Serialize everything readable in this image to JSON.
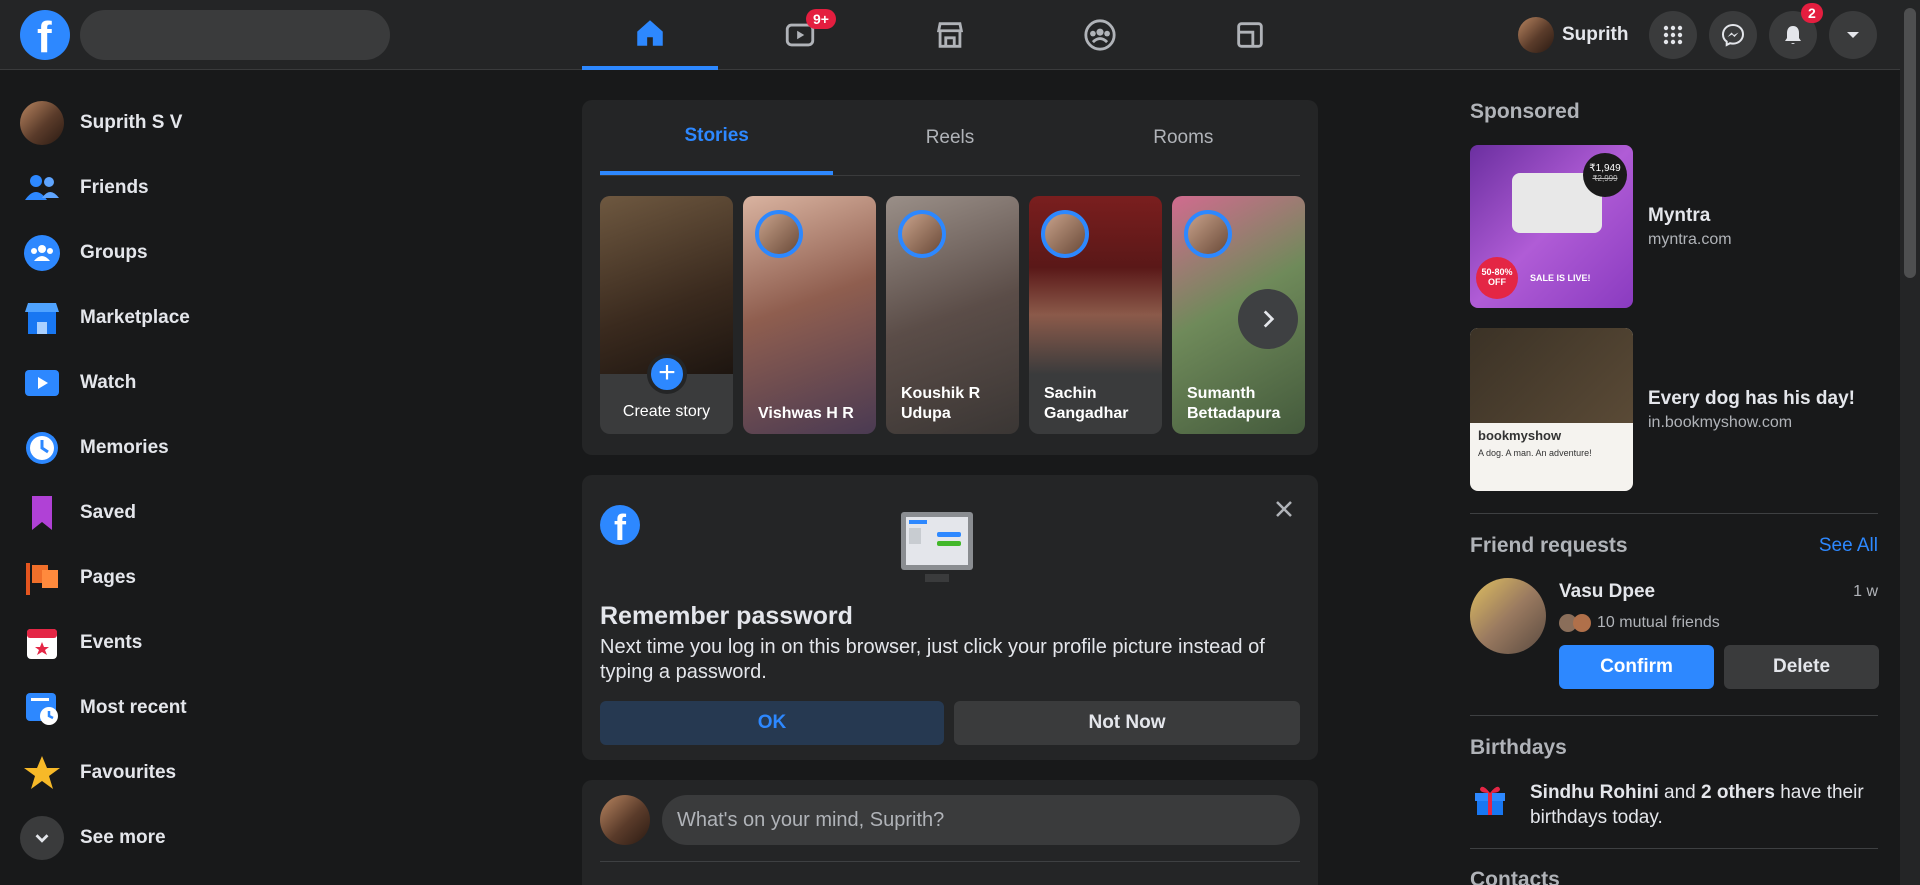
{
  "header": {
    "logo_letter": "f",
    "nav_tabs": [
      {
        "name": "home",
        "active": true
      },
      {
        "name": "watch",
        "badge": "9+"
      },
      {
        "name": "marketplace"
      },
      {
        "name": "groups"
      },
      {
        "name": "gaming"
      }
    ],
    "profile_name": "Suprith",
    "notification_badge": "2"
  },
  "sidebar": {
    "items": [
      {
        "label": "Suprith S V",
        "icon": "profile-avatar"
      },
      {
        "label": "Friends",
        "icon": "friends-icon"
      },
      {
        "label": "Groups",
        "icon": "groups-icon"
      },
      {
        "label": "Marketplace",
        "icon": "marketplace-icon"
      },
      {
        "label": "Watch",
        "icon": "watch-icon"
      },
      {
        "label": "Memories",
        "icon": "memories-icon"
      },
      {
        "label": "Saved",
        "icon": "saved-icon"
      },
      {
        "label": "Pages",
        "icon": "pages-icon"
      },
      {
        "label": "Events",
        "icon": "events-icon"
      },
      {
        "label": "Most recent",
        "icon": "most-recent-icon"
      },
      {
        "label": "Favourites",
        "icon": "favourites-icon"
      },
      {
        "label": "See more",
        "icon": "chevron-down-icon"
      }
    ]
  },
  "stories": {
    "tabs": [
      "Stories",
      "Reels",
      "Rooms"
    ],
    "create_label": "Create story",
    "items": [
      {
        "name": "Vishwas H R"
      },
      {
        "name": "Koushik R Udupa"
      },
      {
        "name": "Sachin Gangadhar"
      },
      {
        "name": "Sumanth Bettadapura"
      }
    ]
  },
  "remember": {
    "title": "Remember password",
    "body": "Next time you log in on this browser, just click your profile picture instead of typing a password.",
    "ok_label": "OK",
    "not_now_label": "Not Now"
  },
  "composer": {
    "placeholder": "What's on your mind, Suprith?"
  },
  "right": {
    "sponsored_title": "Sponsored",
    "ads": [
      {
        "title": "Myntra",
        "url": "myntra.com",
        "price": "₹1,949",
        "old_price": "₹2,999",
        "discount": "50-80% OFF",
        "banner": "SALE IS LIVE!"
      },
      {
        "title": "Every dog has his day!",
        "url": "in.bookmyshow.com",
        "brand": "bookmyshow",
        "tagline": "A dog. A man. An adventure!"
      }
    ],
    "friend_requests_title": "Friend requests",
    "see_all": "See All",
    "request": {
      "name": "Vasu Dpee",
      "time": "1 w",
      "mutual": "10 mutual friends",
      "confirm": "Confirm",
      "delete": "Delete"
    },
    "birthdays_title": "Birthdays",
    "birthday": {
      "name": "Sindhu Rohini",
      "and": " and ",
      "others": "2 others",
      "rest": " have their birthdays today."
    },
    "contacts_title": "Contacts"
  },
  "colors": {
    "accent": "#2d88ff",
    "background": "#18191a",
    "surface": "#242526",
    "badge": "#e41e3f"
  }
}
